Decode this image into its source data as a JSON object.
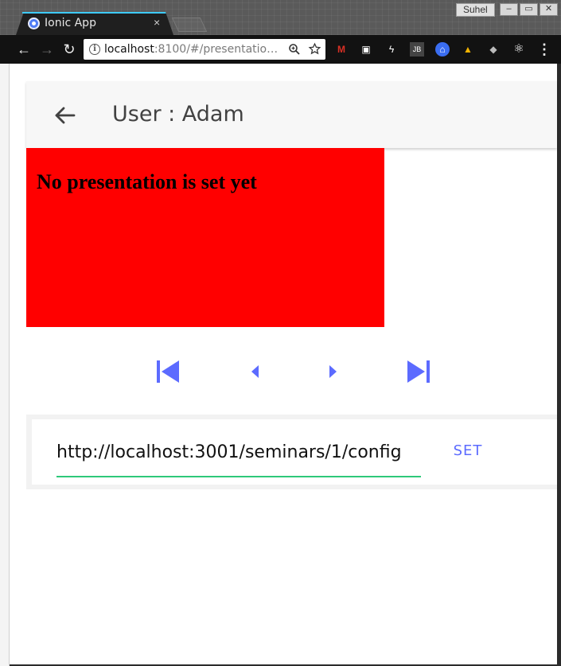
{
  "browser": {
    "tab_title": "Ionic App",
    "tab_close": "×",
    "user": "Suhel",
    "window_controls": [
      "–",
      "▭",
      "✕"
    ],
    "url_host": "localhost",
    "url_rest": ":8100/#/presentation-r...",
    "nav": {
      "back": "←",
      "forward": "→",
      "reload": "↻"
    },
    "omnibox_icons": [
      "zoom-icon",
      "star-icon"
    ],
    "menu": "⋮",
    "extensions": [
      {
        "name": "gmail-icon",
        "glyph": "M",
        "color": "#d93025"
      },
      {
        "name": "camera-icon",
        "glyph": "▣",
        "color": "#cfcfcf"
      },
      {
        "name": "bolt-icon",
        "glyph": "ϟ",
        "color": "#e0e0e0"
      },
      {
        "name": "jetbrains-icon",
        "glyph": "JB",
        "color": "#e0e0e0"
      },
      {
        "name": "bank-icon",
        "glyph": "⌂",
        "color": "#3a6df0"
      },
      {
        "name": "drive-icon",
        "glyph": "▲",
        "color": "#f4b400"
      },
      {
        "name": "cube-icon",
        "glyph": "◆",
        "color": "#bbbbbb"
      },
      {
        "name": "react-icon",
        "glyph": "⚛",
        "color": "#e8e8e8"
      }
    ]
  },
  "header": {
    "title": "User : Adam"
  },
  "presentation": {
    "message": "No presentation is set yet",
    "background": "#ff0000"
  },
  "controls": {
    "accent": "#5c6bff",
    "buttons": [
      "first-slide",
      "previous-slide",
      "next-slide",
      "last-slide"
    ]
  },
  "config": {
    "url_value": "http://localhost:3001/seminars/1/config",
    "set_label": "SET",
    "underline_color": "#2ec97a"
  }
}
